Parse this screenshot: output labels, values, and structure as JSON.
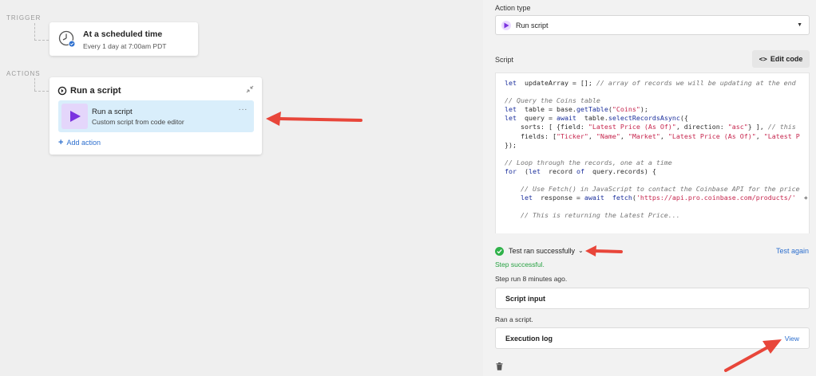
{
  "canvas": {
    "labels": {
      "trigger": "TRIGGER",
      "actions": "ACTIONS"
    },
    "trigger_card": {
      "title": "At a scheduled time",
      "subtitle": "Every 1 day at 7:00am PDT",
      "icon": "clock-icon"
    },
    "action_card": {
      "title": "Run a script",
      "step": {
        "title": "Run a script",
        "subtitle": "Custom script from code editor",
        "more": "···"
      },
      "add_action": "Add action"
    }
  },
  "panel": {
    "action_type_label": "Action type",
    "action_type_value": "Run script",
    "script_label": "Script",
    "edit_code_label": "Edit code",
    "code_lines": [
      [
        [
          "kw",
          "let"
        ],
        [
          "",
          "  updateArray = []; "
        ],
        [
          "cm",
          "// array of records we will be updating at the end"
        ]
      ],
      [],
      [
        [
          "cm",
          "// Query the Coins table"
        ]
      ],
      [
        [
          "kw",
          "let"
        ],
        [
          "",
          "  table = base."
        ],
        [
          "kw",
          "getTable"
        ],
        [
          "",
          "("
        ],
        [
          "str",
          "\"Coins\""
        ],
        [
          "",
          ");"
        ]
      ],
      [
        [
          "kw",
          "let"
        ],
        [
          "",
          "  query = "
        ],
        [
          "kw",
          "await"
        ],
        [
          "",
          "  table."
        ],
        [
          "kw",
          "selectRecordsAsync"
        ],
        [
          "",
          "({"
        ]
      ],
      [
        [
          "",
          "    sorts: [ {field: "
        ],
        [
          "str",
          "\"Latest Price (As Of)\""
        ],
        [
          "",
          ", direction: "
        ],
        [
          "str",
          "\"asc\""
        ],
        [
          "",
          "} ], "
        ],
        [
          "cm",
          "// this"
        ]
      ],
      [
        [
          "",
          "    fields: ["
        ],
        [
          "str",
          "\"Ticker\""
        ],
        [
          "",
          ", "
        ],
        [
          "str",
          "\"Name\""
        ],
        [
          "",
          ", "
        ],
        [
          "str",
          "\"Market\""
        ],
        [
          "",
          ", "
        ],
        [
          "str",
          "\"Latest Price (As Of)\""
        ],
        [
          "",
          ", "
        ],
        [
          "str",
          "\"Latest P"
        ]
      ],
      [
        [
          "",
          "});"
        ]
      ],
      [],
      [
        [
          "cm",
          "// Loop through the records, one at a time"
        ]
      ],
      [
        [
          "kw",
          "for"
        ],
        [
          "",
          "  ("
        ],
        [
          "kw",
          "let"
        ],
        [
          "",
          "  record "
        ],
        [
          "kw",
          "of"
        ],
        [
          "",
          "  query.records) {"
        ]
      ],
      [],
      [
        [
          "",
          "    "
        ],
        [
          "cm",
          "// Use Fetch() in JavaScript to contact the Coinbase API for the price"
        ]
      ],
      [
        [
          "",
          "    "
        ],
        [
          "kw",
          "let"
        ],
        [
          "",
          "  response = "
        ],
        [
          "kw",
          "await"
        ],
        [
          "",
          "  "
        ],
        [
          "kw",
          "fetch"
        ],
        [
          "",
          "("
        ],
        [
          "str",
          "'https://api.pro.coinbase.com/products/'"
        ],
        [
          "",
          "  +"
        ]
      ],
      [],
      [
        [
          "",
          "    "
        ],
        [
          "cm",
          "// This is returning the Latest Price..."
        ]
      ]
    ],
    "status_text": "Test ran successfully",
    "test_again": "Test again",
    "step_success": "Step successful.",
    "step_run": "Step run 8 minutes ago.",
    "script_input": "Script input",
    "ran_a_script": "Ran a script.",
    "execution_log": "Execution log",
    "view": "View"
  },
  "colors": {
    "accent_blue": "#2d6fce",
    "success_green": "#2fb24a",
    "script_purple": "#7b33e0",
    "annotation_red": "#e8463a"
  }
}
